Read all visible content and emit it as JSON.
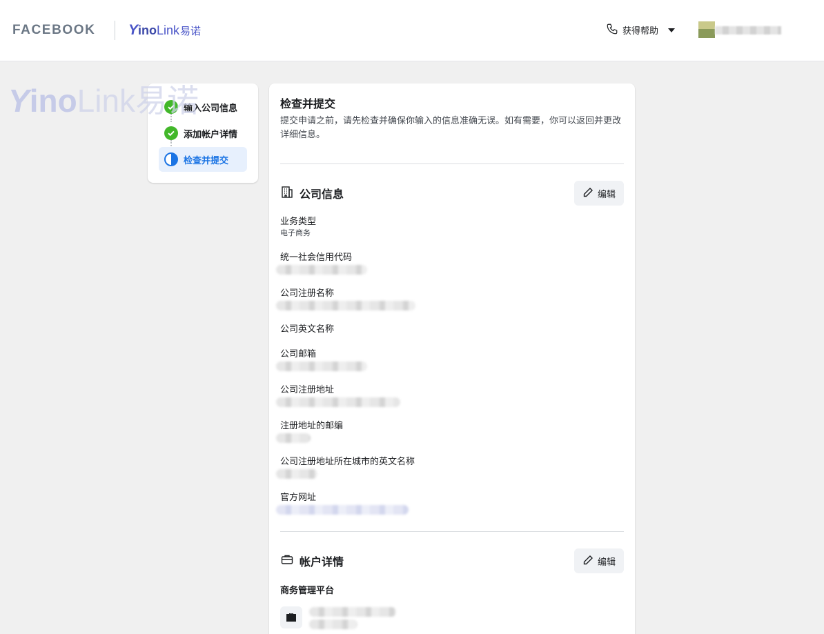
{
  "header": {
    "facebook_logo": "FACEBOOK",
    "brand": {
      "y": "Y",
      "ino": "ino",
      "link": "Link",
      "cn": "易诺"
    },
    "help_label": "获得帮助"
  },
  "watermark": {
    "y": "Y",
    "ino": "ino",
    "link": "Link",
    "cn": "易诺"
  },
  "stepper": {
    "steps": [
      {
        "label": "输入公司信息",
        "status": "done"
      },
      {
        "label": "添加帐户详情",
        "status": "done"
      },
      {
        "label": "检查并提交",
        "status": "current"
      }
    ]
  },
  "main": {
    "title": "检查并提交",
    "description": "提交申请之前，请先检查并确保你输入的信息准确无误。如有需要，你可以返回并更改详细信息。",
    "company_section": {
      "title": "公司信息",
      "edit_label": "编辑",
      "fields": [
        {
          "label": "业务类型",
          "value": "电子商务"
        },
        {
          "label": "统一社会信用代码"
        },
        {
          "label": "公司注册名称"
        },
        {
          "label": "公司英文名称"
        },
        {
          "label": "公司邮箱"
        },
        {
          "label": "公司注册地址"
        },
        {
          "label": "注册地址的邮编"
        },
        {
          "label": "公司注册地址所在城市的英文名称"
        },
        {
          "label": "官方网址"
        }
      ]
    },
    "account_section": {
      "title": "帐户详情",
      "edit_label": "编辑",
      "business_manager_label": "商务管理平台"
    }
  },
  "colors": {
    "primary_blue": "#1b74e4",
    "success_green": "#42b72a",
    "brand_purple": "#4a55c8"
  },
  "icons": [
    "phone-icon",
    "caret-down-icon",
    "check-icon",
    "half-circle-icon",
    "building-icon",
    "pencil-icon",
    "briefcase-icon"
  ]
}
